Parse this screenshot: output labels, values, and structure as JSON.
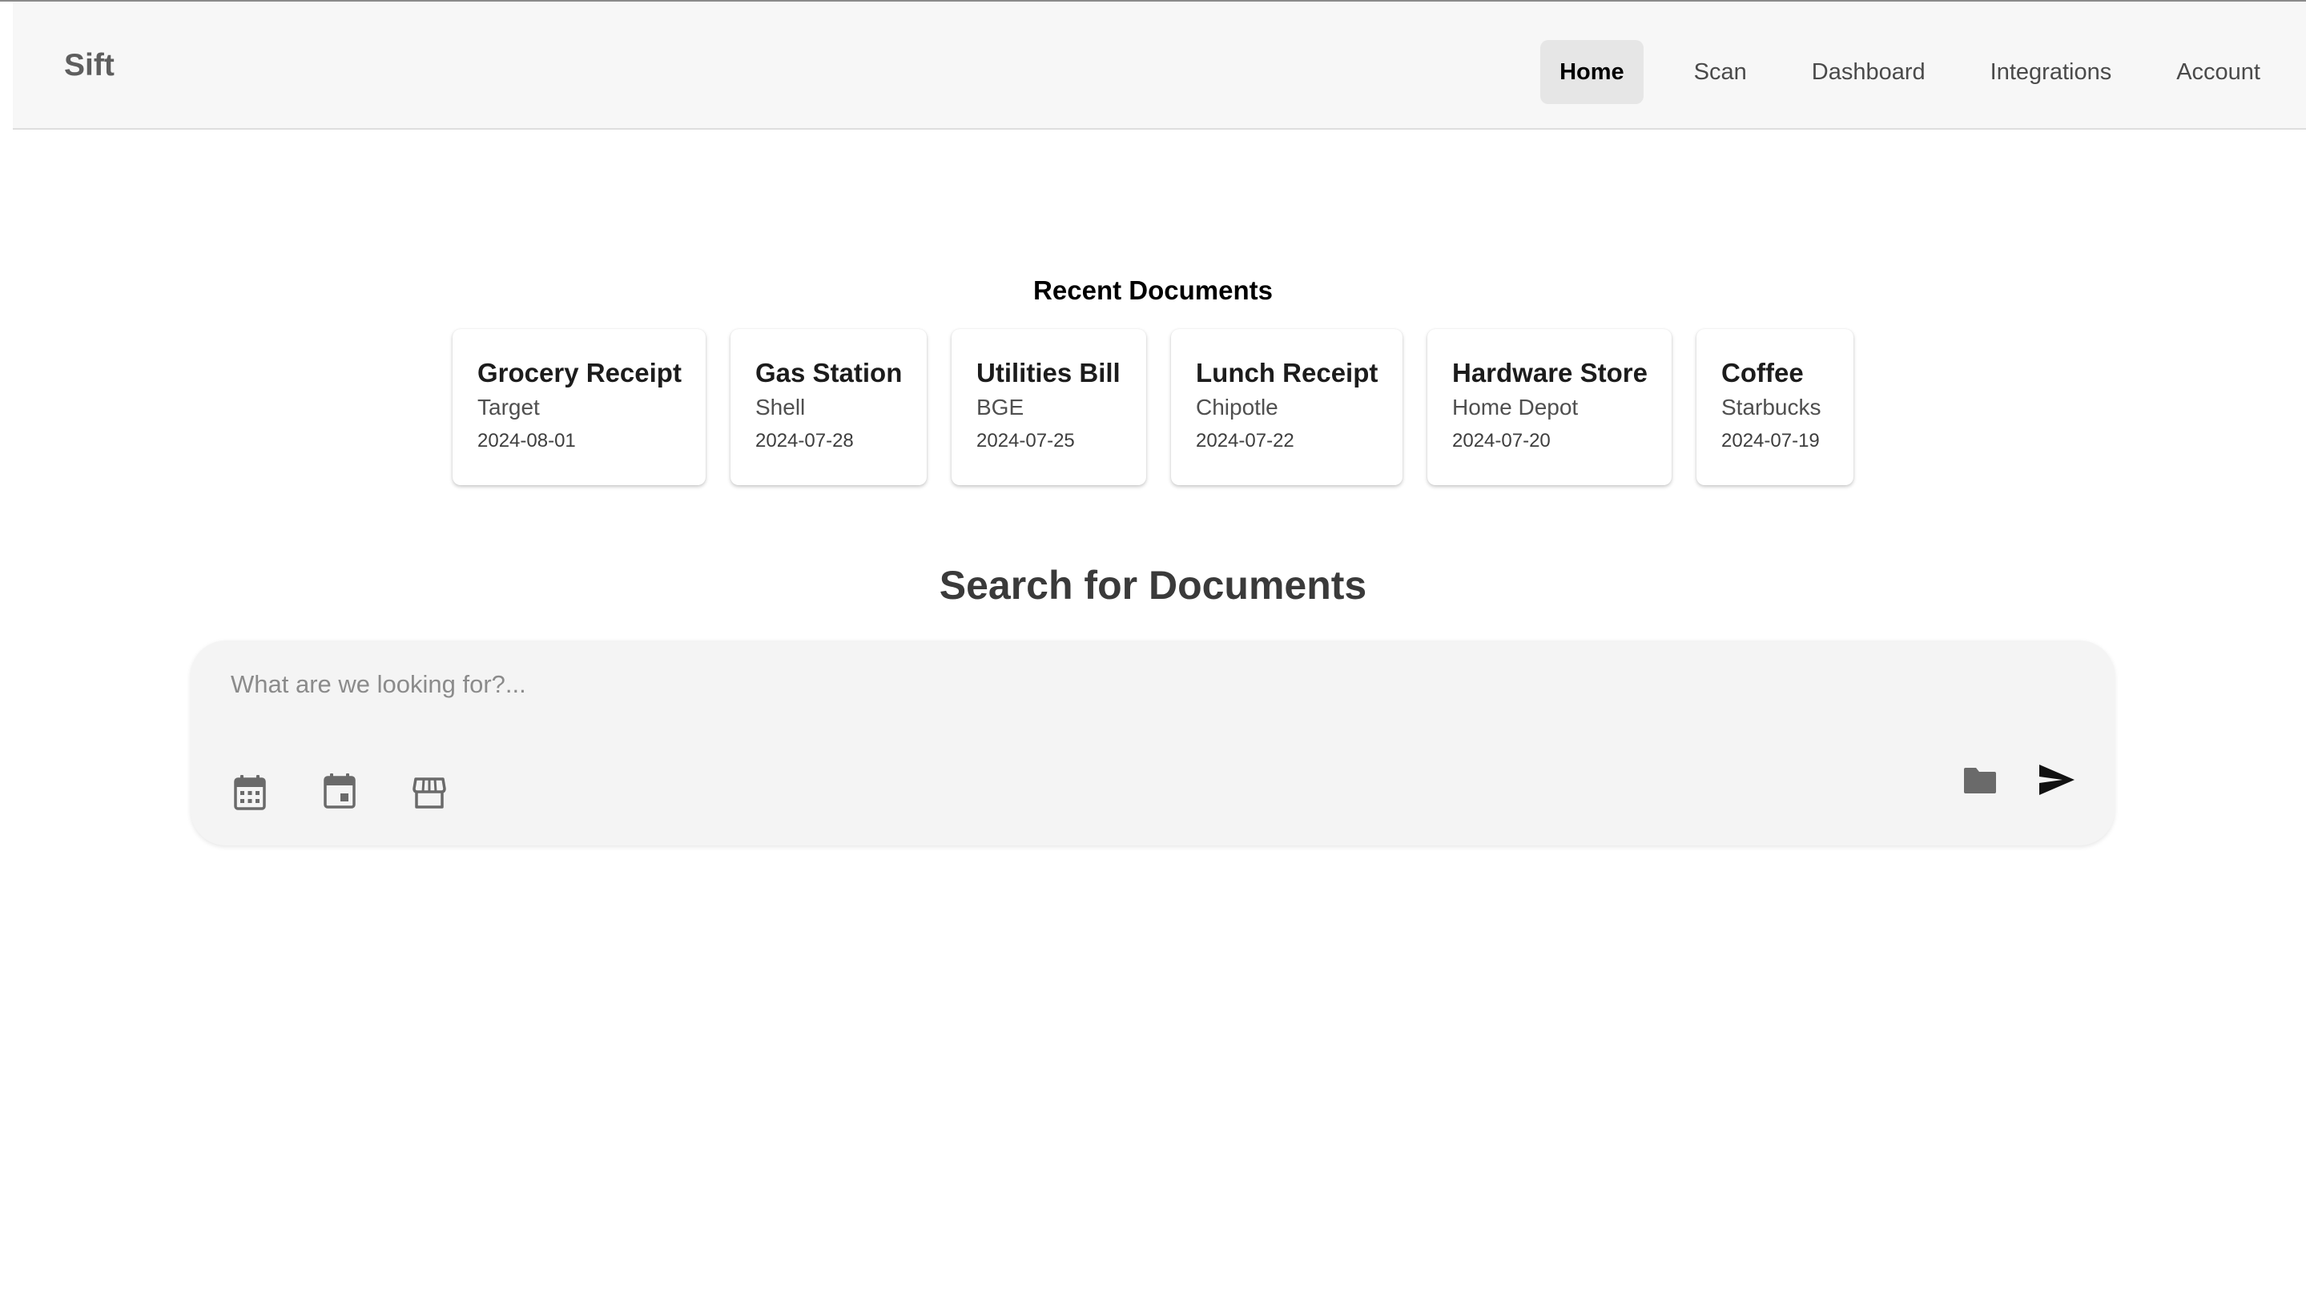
{
  "brand": "Sift",
  "nav": {
    "items": [
      {
        "label": "Home",
        "active": true
      },
      {
        "label": "Scan",
        "active": false
      },
      {
        "label": "Dashboard",
        "active": false
      },
      {
        "label": "Integrations",
        "active": false
      },
      {
        "label": "Account",
        "active": false
      }
    ]
  },
  "recent": {
    "title": "Recent Documents",
    "cards": [
      {
        "title": "Grocery Receipt",
        "vendor": "Target",
        "date": "2024-08-01"
      },
      {
        "title": "Gas Station",
        "vendor": "Shell",
        "date": "2024-07-28"
      },
      {
        "title": "Utilities Bill",
        "vendor": "BGE",
        "date": "2024-07-25"
      },
      {
        "title": "Lunch Receipt",
        "vendor": "Chipotle",
        "date": "2024-07-22"
      },
      {
        "title": "Hardware Store",
        "vendor": "Home Depot",
        "date": "2024-07-20"
      },
      {
        "title": "Coffee",
        "vendor": "Starbucks",
        "date": "2024-07-19"
      }
    ]
  },
  "search": {
    "title": "Search for Documents",
    "placeholder": "What are we looking for?...",
    "value": "",
    "icons": {
      "left": [
        "calendar-month-icon",
        "event-icon",
        "store-icon"
      ],
      "right": [
        "folder-icon",
        "send-icon"
      ]
    }
  },
  "colors": {
    "navbar_bg": "#f7f7f7",
    "active_tab_bg": "#e6e6e6",
    "search_box_bg": "#f4f4f4",
    "icon_gray": "#6a6a6a",
    "send_icon": "#111111"
  }
}
